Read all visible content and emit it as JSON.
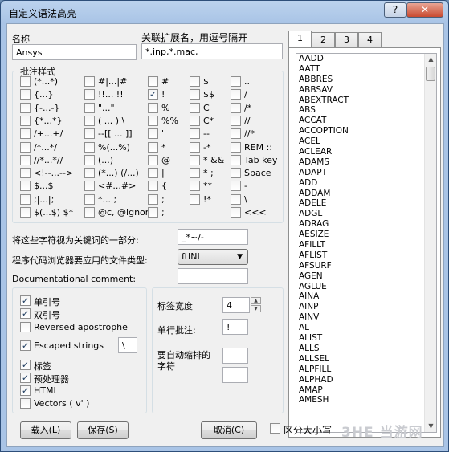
{
  "window": {
    "title": "自定义语法高亮",
    "help_label": "?",
    "close_label": "✕"
  },
  "name": {
    "label": "名称",
    "value": "Ansys"
  },
  "ext": {
    "label": "关联扩展名，用逗号隔开",
    "value": "*.inp,*.mac,"
  },
  "comment_style": {
    "label": "批注样式",
    "items": [
      {
        "label": "(*...*)",
        "checked": false
      },
      {
        "label": "{...}",
        "checked": false
      },
      {
        "label": "{-...-}",
        "checked": false
      },
      {
        "label": "{*...*}",
        "checked": false
      },
      {
        "label": "/+...+/",
        "checked": false
      },
      {
        "label": "/*...*/",
        "checked": false
      },
      {
        "label": "//*...*//",
        "checked": false
      },
      {
        "label": "<!--...-->",
        "checked": false
      },
      {
        "label": "$...$",
        "checked": false
      },
      {
        "label": ";|...|;",
        "checked": false
      },
      {
        "label": "$(...$)  $*",
        "checked": false
      },
      {
        "label": "#|...|#",
        "checked": false
      },
      {
        "label": "!!... !!",
        "checked": false
      },
      {
        "label": "\"...\"",
        "checked": false
      },
      {
        "label": "( ... )  \\",
        "checked": false
      },
      {
        "label": "--[[ ... ]]",
        "checked": false
      },
      {
        "label": "%(...%)",
        "checked": false
      },
      {
        "label": "(...)",
        "checked": false
      },
      {
        "label": "(*...)  (/...)",
        "checked": false
      },
      {
        "label": "<#...#>",
        "checked": false
      },
      {
        "label": "*... ;",
        "checked": false
      },
      {
        "label": "@c, @ignor",
        "checked": false
      },
      {
        "label": "#",
        "checked": false
      },
      {
        "label": "!",
        "checked": true
      },
      {
        "label": "%",
        "checked": false
      },
      {
        "label": "%%",
        "checked": false
      },
      {
        "label": "'",
        "checked": false
      },
      {
        "label": "*",
        "checked": false
      },
      {
        "label": "@",
        "checked": false
      },
      {
        "label": "|",
        "checked": false
      },
      {
        "label": "{",
        "checked": false
      },
      {
        "label": ";",
        "checked": false
      },
      {
        "label": ";",
        "checked": false
      },
      {
        "label": "$",
        "checked": false
      },
      {
        "label": "$$",
        "checked": false
      },
      {
        "label": "C",
        "checked": false
      },
      {
        "label": "C*",
        "checked": false
      },
      {
        "label": "--",
        "checked": false
      },
      {
        "label": "-*",
        "checked": false
      },
      {
        "label": "*  &&",
        "checked": false
      },
      {
        "label": "* ;",
        "checked": false
      },
      {
        "label": "**",
        "checked": false
      },
      {
        "label": "!*",
        "checked": false
      },
      {
        "label": "..",
        "checked": false
      },
      {
        "label": "/",
        "checked": false
      },
      {
        "label": "/*",
        "checked": false
      },
      {
        "label": "//",
        "checked": false
      },
      {
        "label": "//*",
        "checked": false
      },
      {
        "label": "REM  ::",
        "checked": false
      },
      {
        "label": "Tab key",
        "checked": false
      },
      {
        "label": "Space",
        "checked": false
      },
      {
        "label": "-",
        "checked": false
      },
      {
        "label": "\\",
        "checked": false
      },
      {
        "label": "<<<",
        "checked": false
      }
    ]
  },
  "keyword_chars": {
    "label": "将这些字符视为关键词的一部分:",
    "value": "_*~/-"
  },
  "browser_type": {
    "label": "程序代码浏览器要应用的文件类型:",
    "value": "ftINI"
  },
  "doc_comment": {
    "label": "Documentational comment:",
    "value": ""
  },
  "options": {
    "single_quote": {
      "label": "单引号",
      "checked": true
    },
    "double_quote": {
      "label": "双引号",
      "checked": true
    },
    "reversed_apostrophe": {
      "label": "Reversed apostrophe",
      "checked": false
    },
    "escaped_strings": {
      "label": "Escaped strings",
      "checked": true,
      "value": "\\"
    },
    "tags": {
      "label": "标签",
      "checked": true
    },
    "preprocessor": {
      "label": "预处理器",
      "checked": true
    },
    "html": {
      "label": "HTML",
      "checked": true
    },
    "vectors": {
      "label": "Vectors ( v' )",
      "checked": false
    }
  },
  "tab_width": {
    "label": "标签宽度",
    "value": "4"
  },
  "line_comment": {
    "label": "单行批注:",
    "value": "!"
  },
  "auto_indent": {
    "label": "要自动缩排的字符",
    "value1": "",
    "value2": ""
  },
  "tabs": [
    "1",
    "2",
    "3",
    "4"
  ],
  "keywords": [
    "AADD",
    "AATT",
    "ABBRES",
    "ABBSAV",
    "ABEXTRACT",
    "ABS",
    "ACCAT",
    "ACCOPTION",
    "ACEL",
    "ACLEAR",
    "ADAMS",
    "ADAPT",
    "ADD",
    "ADDAM",
    "ADELE",
    "ADGL",
    "ADRAG",
    "AESIZE",
    "AFILLT",
    "AFLIST",
    "AFSURF",
    "AGEN",
    "AGLUE",
    "AINA",
    "AINP",
    "AINV",
    "AL",
    "ALIST",
    "ALLS",
    "ALLSEL",
    "ALPFILL",
    "ALPHAD",
    "AMAP",
    "AMESH"
  ],
  "buttons": {
    "load": "载入(L)",
    "save": "保存(S)",
    "cancel": "取消(C)"
  },
  "case_sensitive": {
    "label": "区分大小写",
    "checked": false
  },
  "watermark": "3HE 当游网"
}
